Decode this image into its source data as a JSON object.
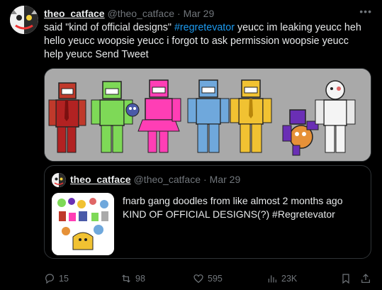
{
  "tweet": {
    "display_name": "theo_catface",
    "handle": "@theo_catface",
    "separator": "·",
    "time": "Mar 29",
    "text_before": "said \"kind of official designs\" ",
    "hashtag": "#regretevator",
    "text_after": " yeucc im leaking yeucc heh hello yeucc woopsie yeucc i forgot to ask permission woopsie yeucc help yeucc Send Tweet",
    "more_icon": "more-icon"
  },
  "quote": {
    "display_name": "theo_catface",
    "handle": "@theo_catface",
    "separator": "·",
    "time": "Mar 29",
    "line1": "fnarb gang doodles from like almost 2 months ago",
    "line2": "KIND OF OFFICIAL DESIGNS(?) #Regretevator"
  },
  "actions": {
    "replies": "15",
    "reposts": "98",
    "likes": "595",
    "views": "23K"
  },
  "colors": {
    "accent": "#1d9bf0",
    "muted": "#71767b",
    "text": "#e7e9ea",
    "background": "#000000",
    "media_bg": "#a9a9a9"
  }
}
